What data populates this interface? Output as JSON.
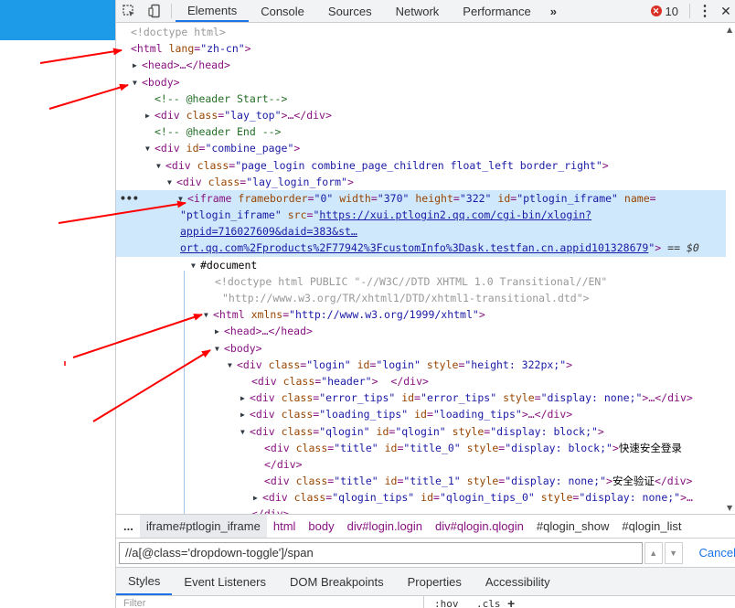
{
  "toolbar": {
    "tabs": [
      "Elements",
      "Console",
      "Sources",
      "Network",
      "Performance"
    ],
    "more": "»",
    "error_count": "10",
    "error_glyph": "✕"
  },
  "tree": {
    "l1": "<!doctype html>",
    "l2_tag_open": "<html",
    "l2_attr": "lang",
    "l2_val": "\"zh-cn\"",
    "l3": "<head>…</head>",
    "l4": "<body>",
    "l5": "<!-- @header Start-->",
    "l6_open": "<div",
    "l6_attr": "class",
    "l6_val": "\"lay_top\"",
    "l6_close": ">…</div>",
    "l7": "<!-- @header End -->",
    "l8_attr": "id",
    "l8_val": "\"combine_page\"",
    "l9_val": "\"page_login combine_page_children float_left border_right\"",
    "l10_val": "\"lay_login_form\"",
    "iframe_attrs": {
      "frameborder": "\"0\"",
      "width": "\"370\"",
      "height": "\"322\"",
      "id": "\"ptlogin_iframe\"",
      "name_val": "\"ptlogin_iframe\"",
      "src_l1": "https://xui.ptlogin2.qq.com/cgi-bin/xlogin?",
      "src_l2": "appid=716027609&daid=383&st…",
      "src_l3": "ort.qq.com%2Fproducts%2F77942%3FcustomInfo%3Dask.testfan.cn.appid101328679",
      "eq": "== $0"
    },
    "document": "#document",
    "doctype_l1": "<!doctype html PUBLIC \"-//W3C//DTD XHTML 1.0 Transitional//EN\"",
    "doctype_l2": "\"http://www.w3.org/TR/xhtml1/DTD/xhtml1-transitional.dtd\">",
    "xmlns_val": "\"http://www.w3.org/1999/xhtml\"",
    "login_style": "\"height: 322px;\"",
    "title0_text": "快速安全登录",
    "title1_text": "安全验证"
  },
  "breadcrumbs": {
    "ellipsis": "...",
    "items": [
      "iframe#ptlogin_iframe",
      "html",
      "body",
      "div#login.login",
      "div#qlogin.qlogin",
      "#qlogin_show",
      "#qlogin_list"
    ]
  },
  "search": {
    "value": "//a[@class='dropdown-toggle']/span",
    "cancel": "Cancel"
  },
  "lower_tabs": [
    "Styles",
    "Event Listeners",
    "DOM Breakpoints",
    "Properties",
    "Accessibility"
  ],
  "filter": {
    "placeholder": "Filter",
    "hov": ":hov",
    "cls": ".cls",
    "plus": "+"
  },
  "colors": {
    "accent": "#1a73e8",
    "tag": "#881280",
    "attr": "#994500",
    "value": "#1a1aa6",
    "comment": "#236e25",
    "selection": "#cfe8fc",
    "arrow": "#ff0000",
    "page_blue": "#1e9be8"
  }
}
